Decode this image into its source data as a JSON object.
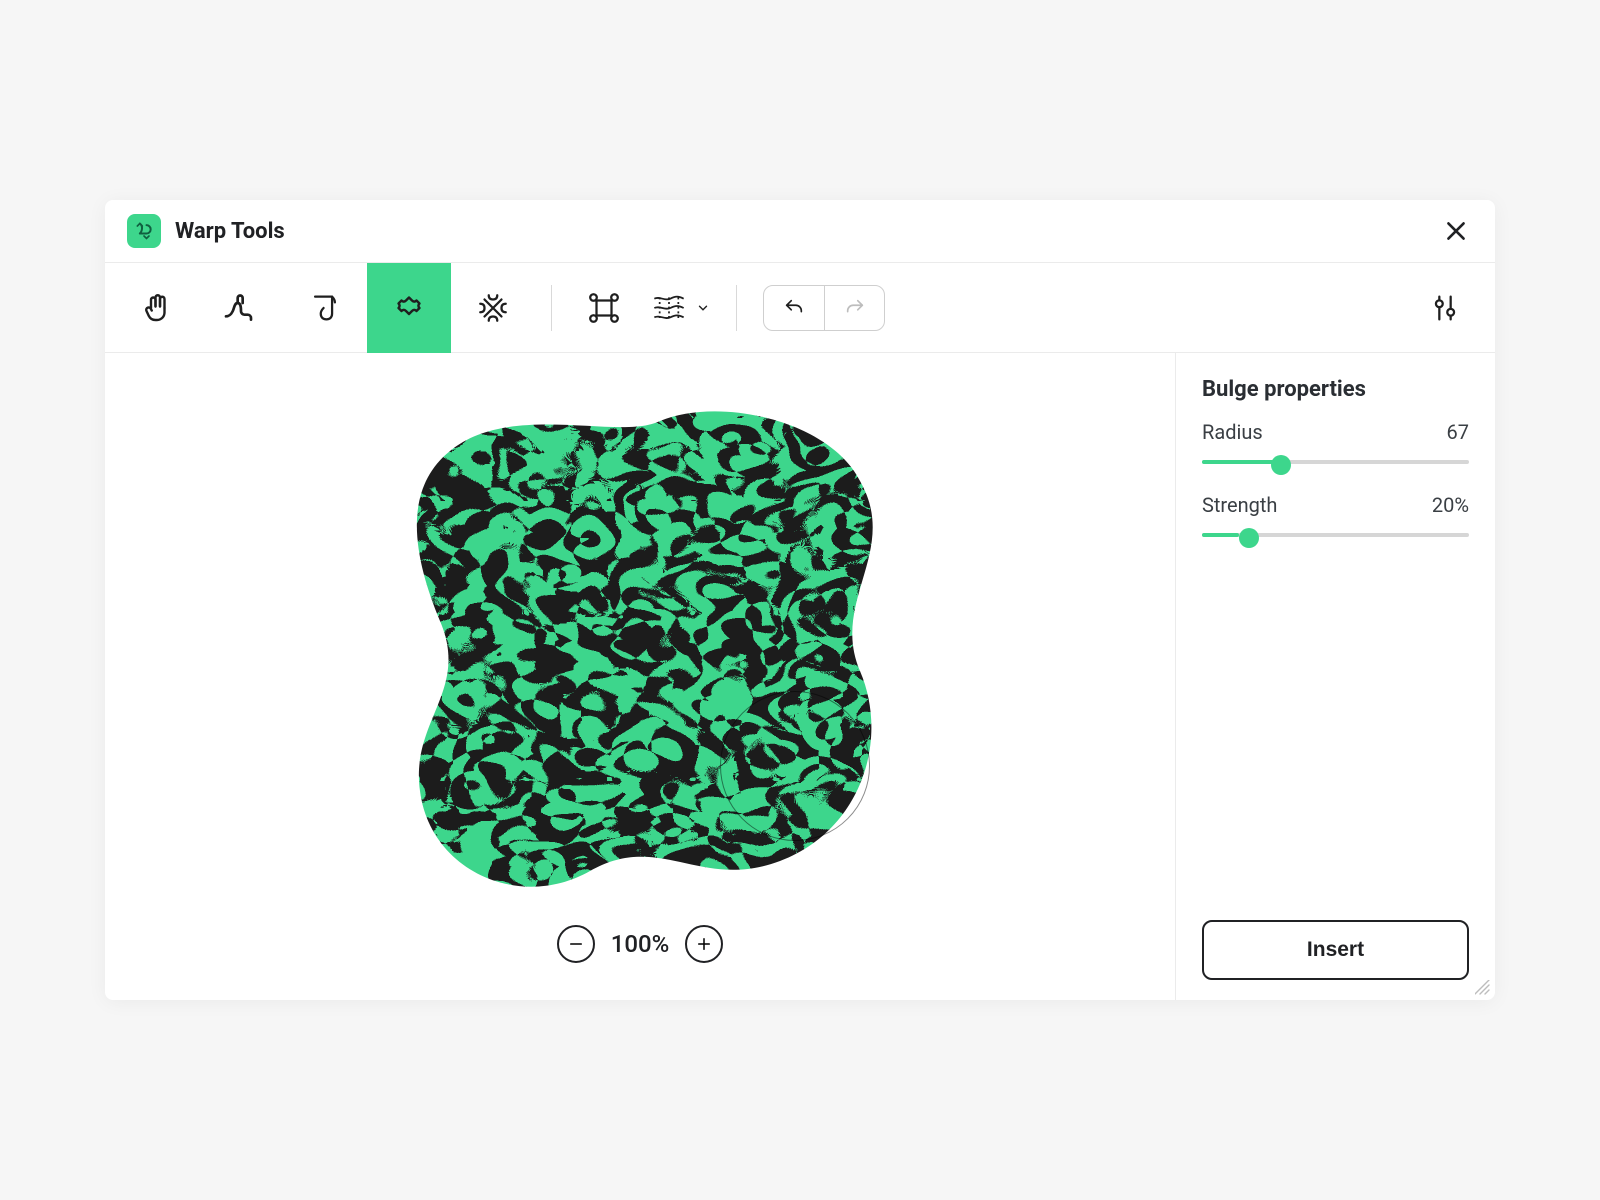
{
  "header": {
    "title": "Warp Tools"
  },
  "toolbar": {
    "tools": [
      {
        "name": "hand",
        "active": false
      },
      {
        "name": "finger",
        "active": false
      },
      {
        "name": "smear",
        "active": false
      },
      {
        "name": "bulge",
        "active": true
      },
      {
        "name": "scramble",
        "active": false
      }
    ],
    "secondary": [
      {
        "name": "transform"
      },
      {
        "name": "mesh"
      }
    ]
  },
  "zoom": {
    "level": "100%"
  },
  "panel": {
    "title": "Bulge properties",
    "radius_label": "Radius",
    "radius_value": "67",
    "radius_pct": 27,
    "strength_label": "Strength",
    "strength_value": "20%",
    "strength_pct": 14,
    "insert_label": "Insert"
  },
  "colors": {
    "accent": "#3dd68c",
    "ink": "#202124"
  }
}
